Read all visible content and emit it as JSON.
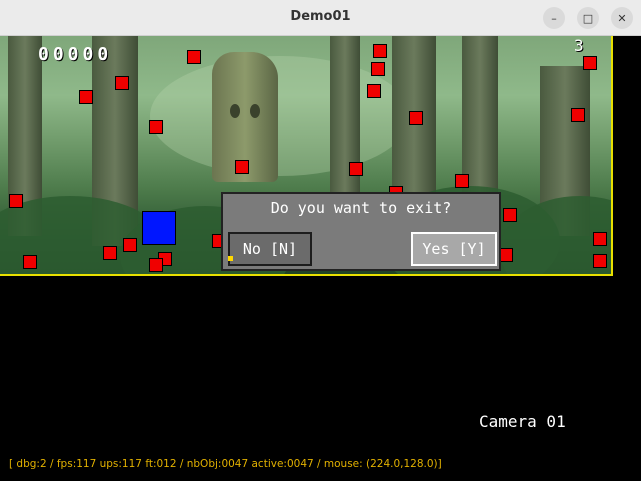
{
  "window": {
    "title": "Demo01",
    "minimize_glyph": "–",
    "maximize_glyph": "□",
    "close_glyph": "✕"
  },
  "hud": {
    "score": "00000",
    "lives": "3",
    "camera_label": "Camera 01",
    "debug_line": "[ dbg:2 / fps:117 ups:117 ft:012 / nbObj:0047 active:0047 / mouse: (224.0,128.0)]"
  },
  "dialog": {
    "message": "Do you want to exit?",
    "no_label": "No [N]",
    "yes_label": "Yes [Y]",
    "selected": "yes"
  },
  "colors": {
    "enemy": "#f00000",
    "player": "#0016ff",
    "viewport_border": "#e8e000",
    "debug_text": "#e2b100"
  }
}
